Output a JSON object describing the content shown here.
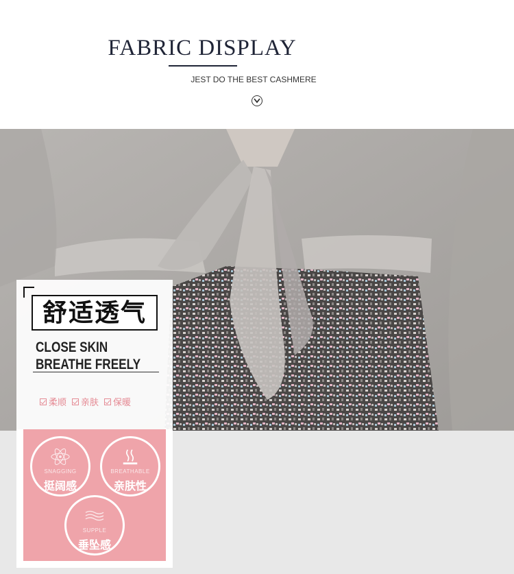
{
  "header": {
    "title": "FABRIC DISPLAY",
    "subtitle": "JEST DO THE BEST CASHMERE"
  },
  "card": {
    "title_cn": "舒适透气",
    "line1": "CLOSE SKIN",
    "line2": "BREATHE FREELY",
    "tags": [
      "柔顺",
      "亲肤",
      "保暖"
    ]
  },
  "features": [
    {
      "en": "SNAGGING",
      "cn": "挺阔感",
      "icon": "atom-icon"
    },
    {
      "en": "BREATHABLE",
      "cn": "亲肤性",
      "icon": "steam-icon"
    },
    {
      "en": "SUPPLE",
      "cn": "垂坠感",
      "icon": "wave-icon"
    }
  ],
  "colors": {
    "pink": "#efa4aa",
    "tag_pink": "#e58b95",
    "title_navy": "#1f2436"
  }
}
